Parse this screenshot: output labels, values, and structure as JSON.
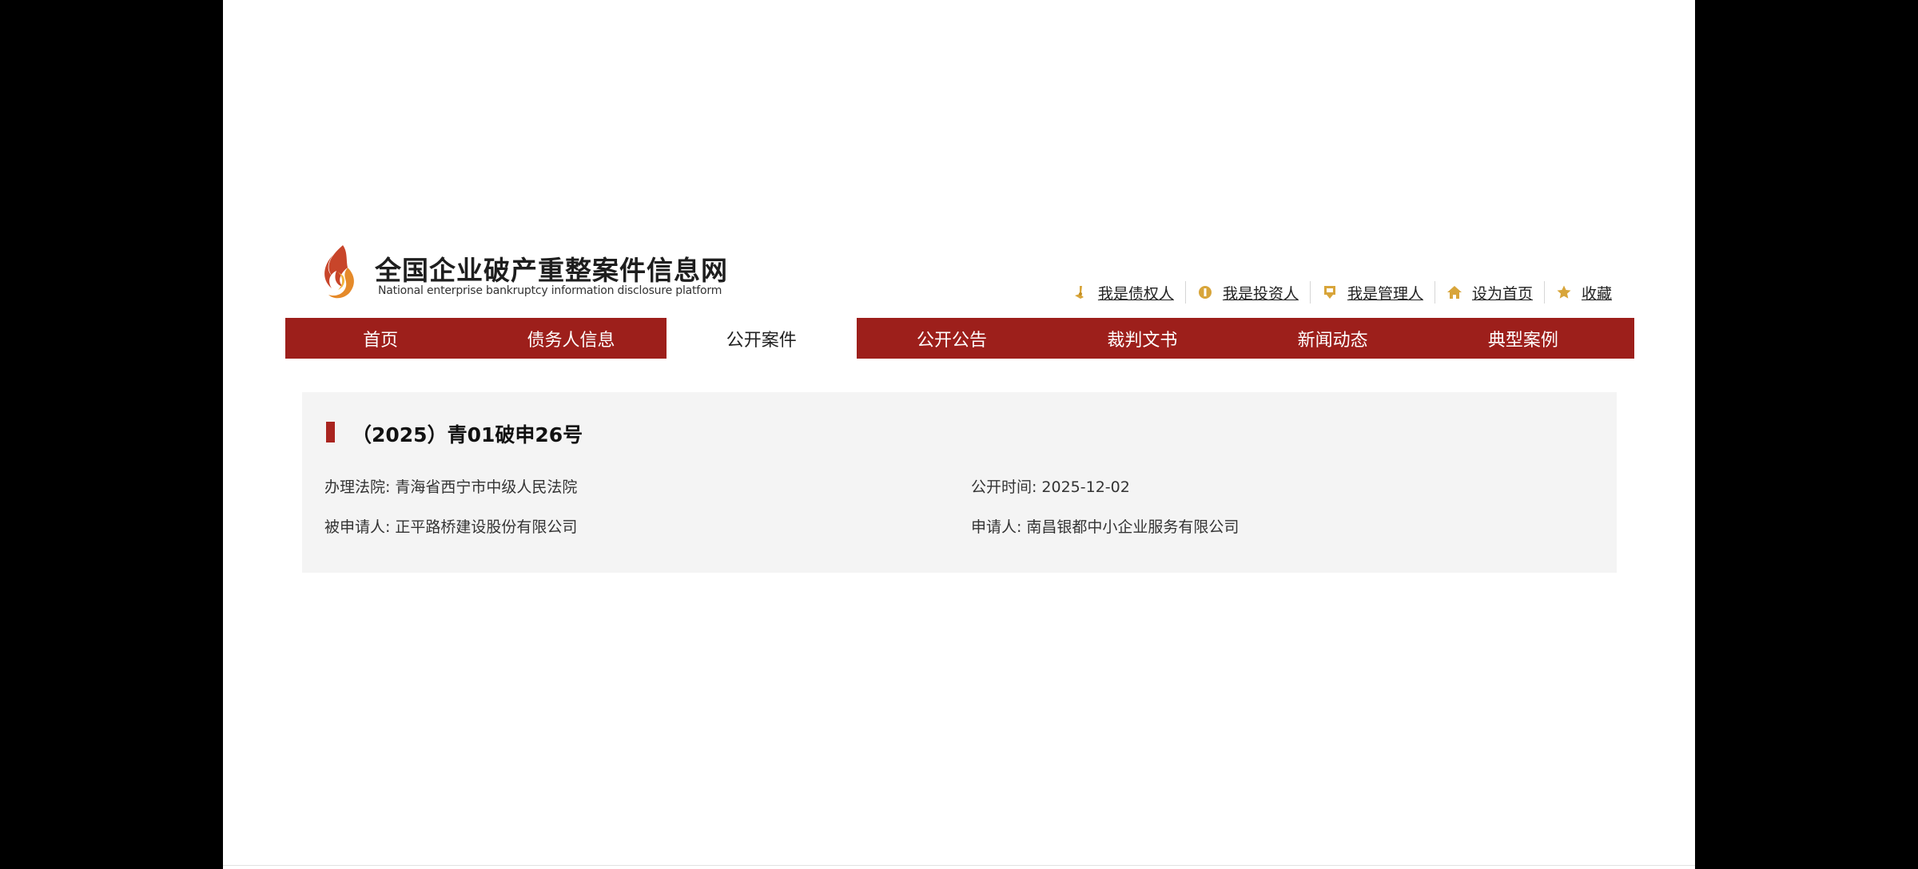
{
  "header": {
    "title": "全国企业破产重整案件信息网",
    "subtitle": "National enterprise bankruptcy  information disclosure platform",
    "quick_links": [
      {
        "label": "我是债权人",
        "icon": "hand-pen-icon"
      },
      {
        "label": "我是投资人",
        "icon": "coin-icon"
      },
      {
        "label": "我是管理人",
        "icon": "badge-icon"
      },
      {
        "label": "设为首页",
        "icon": "home-icon"
      },
      {
        "label": "收藏",
        "icon": "star-icon"
      }
    ]
  },
  "nav": {
    "items": [
      {
        "label": "首页"
      },
      {
        "label": "债务人信息"
      },
      {
        "label": "公开案件"
      },
      {
        "label": "公开公告"
      },
      {
        "label": "裁判文书"
      },
      {
        "label": "新闻动态"
      },
      {
        "label": "典型案例"
      }
    ],
    "active_index": 2
  },
  "case": {
    "title": "（2025）青01破申26号",
    "court_label": "办理法院:",
    "court_value": "青海省西宁市中级人民法院",
    "date_label": "公开时间:",
    "date_value": "2025-12-02",
    "respondent_label": "被申请人:",
    "respondent_value": "正平路桥建设股份有限公司",
    "applicant_label": "申请人:",
    "applicant_value": "南昌银都中小企业服务有限公司"
  },
  "colors": {
    "brand_red": "#9d1f1b",
    "icon_gold": "#d8a53a",
    "card_bg": "#f4f4f4"
  }
}
